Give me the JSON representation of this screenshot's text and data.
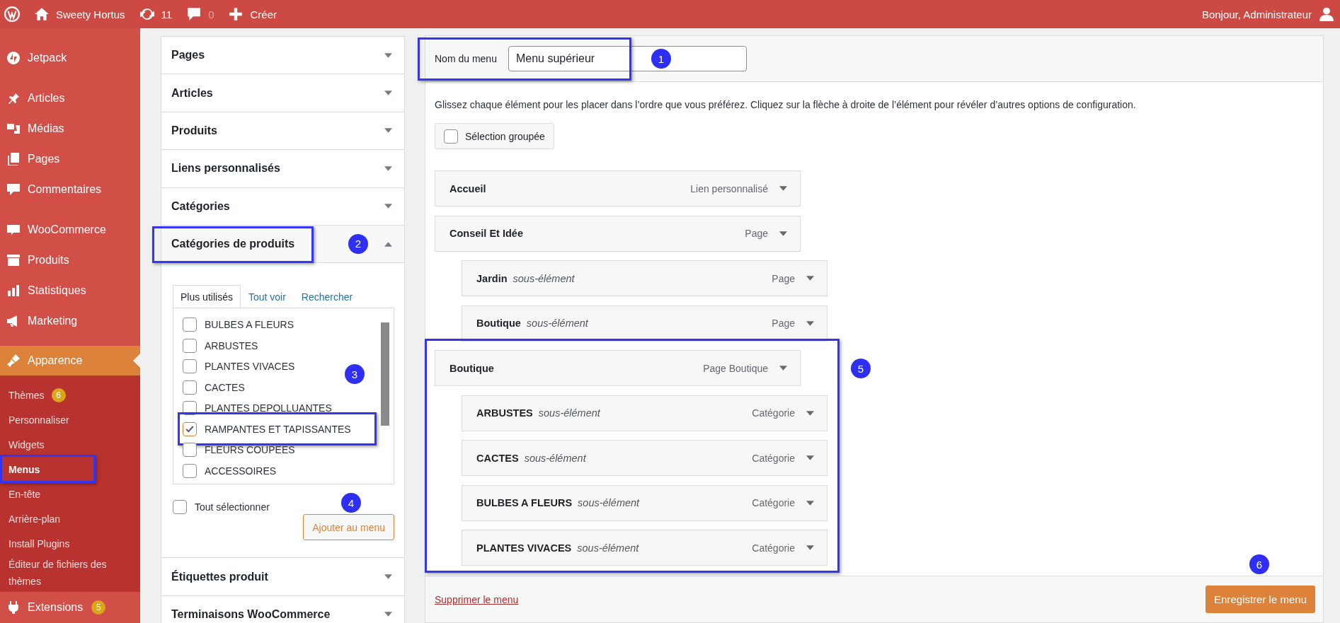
{
  "top_bar": {
    "site_name": "Sweety Hortus",
    "updates": "11",
    "comments": "0",
    "new_label": "Créer",
    "greeting": "Bonjour, Administrateur"
  },
  "sidebar": {
    "groups": [
      [
        {
          "label": "Jetpack",
          "selected": false
        }
      ],
      [
        {
          "label": "Articles",
          "selected": false
        },
        {
          "label": "Médias",
          "selected": false
        },
        {
          "label": "Pages",
          "selected": false
        },
        {
          "label": "Commentaires",
          "selected": false
        }
      ],
      [
        {
          "label": "WooCommerce",
          "selected": false
        },
        {
          "label": "Produits",
          "selected": false
        },
        {
          "label": "Statistiques",
          "selected": false
        },
        {
          "label": "Marketing",
          "selected": false
        }
      ],
      [
        {
          "label": "Apparence",
          "selected": true,
          "submenu": [
            {
              "label": "Thèmes",
              "selected": false,
              "highlighted": false,
              "count": "6"
            },
            {
              "label": "Personnaliser",
              "selected": false,
              "highlighted": false
            },
            {
              "label": "Widgets",
              "selected": false,
              "highlighted": false
            },
            {
              "label": "Menus",
              "selected": true,
              "highlighted": true
            },
            {
              "label": "En-tête",
              "selected": false,
              "highlighted": false
            },
            {
              "label": "Arrière-plan",
              "selected": false,
              "highlighted": false
            },
            {
              "label": "Install Plugins",
              "selected": false,
              "highlighted": false
            },
            {
              "label": "Éditeur de fichiers des thèmes",
              "selected": false,
              "highlighted": false
            }
          ]
        },
        {
          "label": "Extensions",
          "selected": false,
          "count": "5"
        }
      ]
    ]
  },
  "accordion": [
    {
      "title": "Pages",
      "expanded": false,
      "highlighted": false
    },
    {
      "title": "Articles",
      "expanded": false,
      "highlighted": false
    },
    {
      "title": "Produits",
      "expanded": false,
      "highlighted": false
    },
    {
      "title": "Liens personnalisés",
      "expanded": false,
      "highlighted": false
    },
    {
      "title": "Catégories",
      "expanded": false,
      "highlighted": false
    },
    {
      "title": "Catégories de produits",
      "expanded": true,
      "highlighted": true,
      "callout": "2",
      "tabs": [
        {
          "label": "Plus utilisés",
          "selected": true
        },
        {
          "label": "Tout voir",
          "selected": false
        },
        {
          "label": "Rechercher",
          "selected": false
        }
      ],
      "checklist": {
        "callout": "3",
        "items": [
          {
            "label": "BULBES A FLEURS",
            "checked": false,
            "highlighted": false
          },
          {
            "label": "ARBUSTES",
            "checked": false,
            "highlighted": false
          },
          {
            "label": "PLANTES VIVACES",
            "checked": false,
            "highlighted": false
          },
          {
            "label": "CACTES",
            "checked": false,
            "highlighted": false
          },
          {
            "label": "PLANTES DEPOLLUANTES",
            "checked": false,
            "highlighted": false
          },
          {
            "label": "RAMPANTES ET TAPISSANTES",
            "checked": true,
            "highlighted": true
          },
          {
            "label": "FLEURS COUPEES",
            "checked": false,
            "highlighted": false
          },
          {
            "label": "ACCESSOIRES",
            "checked": false,
            "highlighted": false
          }
        ]
      },
      "select_all": {
        "label": "Tout sélectionner",
        "checked": false
      },
      "add_button": {
        "label": "Ajouter au menu",
        "callout": "4"
      }
    },
    {
      "title": "Étiquettes produit",
      "expanded": false,
      "highlighted": false
    },
    {
      "title": "Terminaisons WooCommerce",
      "expanded": false,
      "highlighted": false
    }
  ],
  "menu_name": {
    "label": "Nom du menu",
    "value": "Menu supérieur",
    "highlighted": true,
    "callout": "1"
  },
  "instructions": "Glissez chaque élément pour les placer dans l’ordre que vous préférez. Cliquez sur la flèche à droite de l’élément pour révéler d’autres options de configuration.",
  "bulk_select": {
    "label": "Sélection groupée",
    "checked": false
  },
  "menu_items": [
    {
      "title": "Accueil",
      "type": "Lien personnalisé",
      "highlighted": false
    },
    {
      "title": "Conseil Et Idée",
      "type": "Page",
      "highlighted": false,
      "children": [
        {
          "title": "Jardin",
          "note": "sous-élément",
          "type": "Page"
        },
        {
          "title": "Boutique",
          "note": "sous-élément",
          "type": "Page"
        }
      ]
    },
    {
      "title": "Boutique",
      "type": "Page Boutique",
      "highlighted": true,
      "callout": "5",
      "children": [
        {
          "title": "ARBUSTES",
          "note": "sous-élément",
          "type": "Catégorie"
        },
        {
          "title": "CACTES",
          "note": "sous-élément",
          "type": "Catégorie"
        },
        {
          "title": "BULBES A FLEURS",
          "note": "sous-élément",
          "type": "Catégorie"
        },
        {
          "title": "PLANTES VIVACES",
          "note": "sous-élément",
          "type": "Catégorie"
        }
      ]
    }
  ],
  "footer": {
    "delete_link": "Supprimer le menu",
    "save_button": {
      "label": "Enregistrer le menu",
      "callout": "6"
    }
  }
}
